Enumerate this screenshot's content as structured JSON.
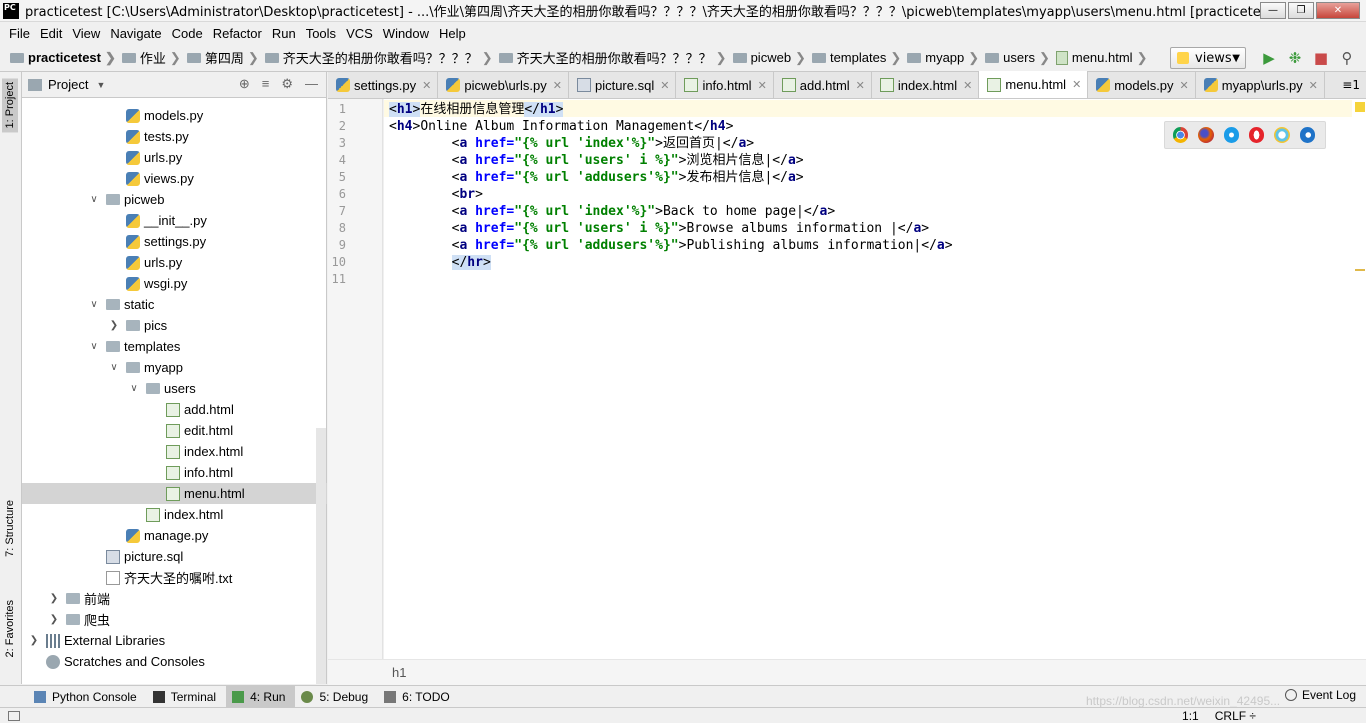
{
  "window": {
    "app_icon": "PC",
    "title": "practicetest [C:\\Users\\Administrator\\Desktop\\practicetest] - ...\\作业\\第四周\\齐天大圣的相册你敢看吗？？？？\\齐天大圣的相册你敢看吗？？？？\\picweb\\templates\\myapp\\users\\menu.html [practicetest] - PyCharm (Ad..."
  },
  "menu": [
    "File",
    "Edit",
    "View",
    "Navigate",
    "Code",
    "Refactor",
    "Run",
    "Tools",
    "VCS",
    "Window",
    "Help"
  ],
  "breadcrumbs": [
    "practicetest",
    "作业",
    "第四周",
    "齐天大圣的相册你敢看吗？？？？",
    "齐天大圣的相册你敢看吗？？？？",
    "picweb",
    "templates",
    "myapp",
    "users",
    "menu.html"
  ],
  "run_config": "views",
  "left_strip": {
    "project": "1: Project",
    "structure": "7: Structure",
    "favorites": "2: Favorites"
  },
  "project_panel": {
    "title": "Project",
    "tree": [
      {
        "label": "models.py",
        "type": "py",
        "depth": 4
      },
      {
        "label": "tests.py",
        "type": "py",
        "depth": 4
      },
      {
        "label": "urls.py",
        "type": "py",
        "depth": 4
      },
      {
        "label": "views.py",
        "type": "py",
        "depth": 4
      },
      {
        "label": "picweb",
        "type": "folder",
        "depth": 3,
        "arrow": "open"
      },
      {
        "label": "__init__.py",
        "type": "py",
        "depth": 4
      },
      {
        "label": "settings.py",
        "type": "py",
        "depth": 4
      },
      {
        "label": "urls.py",
        "type": "py",
        "depth": 4
      },
      {
        "label": "wsgi.py",
        "type": "py",
        "depth": 4
      },
      {
        "label": "static",
        "type": "folder",
        "depth": 3,
        "arrow": "open"
      },
      {
        "label": "pics",
        "type": "folder",
        "depth": 4,
        "arrow": "closed"
      },
      {
        "label": "templates",
        "type": "folder",
        "depth": 3,
        "arrow": "open"
      },
      {
        "label": "myapp",
        "type": "folder",
        "depth": 4,
        "arrow": "open"
      },
      {
        "label": "users",
        "type": "folder",
        "depth": 5,
        "arrow": "open"
      },
      {
        "label": "add.html",
        "type": "html",
        "depth": 6
      },
      {
        "label": "edit.html",
        "type": "html",
        "depth": 6
      },
      {
        "label": "index.html",
        "type": "html",
        "depth": 6
      },
      {
        "label": "info.html",
        "type": "html",
        "depth": 6
      },
      {
        "label": "menu.html",
        "type": "html",
        "depth": 6,
        "selected": true
      },
      {
        "label": "index.html",
        "type": "html",
        "depth": 5
      },
      {
        "label": "manage.py",
        "type": "py",
        "depth": 4
      },
      {
        "label": "picture.sql",
        "type": "sql",
        "depth": 3
      },
      {
        "label": "齐天大圣的嘱咐.txt",
        "type": "txt",
        "depth": 3
      },
      {
        "label": "前端",
        "type": "folder",
        "depth": 1,
        "arrow": "closed"
      },
      {
        "label": "爬虫",
        "type": "folder",
        "depth": 1,
        "arrow": "closed"
      },
      {
        "label": "External Libraries",
        "type": "lib",
        "depth": 0,
        "arrow": "closed"
      },
      {
        "label": "Scratches and Consoles",
        "type": "scratch",
        "depth": 0
      }
    ]
  },
  "tabs": [
    {
      "label": "settings.py",
      "type": "py"
    },
    {
      "label": "picweb\\urls.py",
      "type": "py"
    },
    {
      "label": "picture.sql",
      "type": "sql"
    },
    {
      "label": "info.html",
      "type": "html"
    },
    {
      "label": "add.html",
      "type": "html"
    },
    {
      "label": "index.html",
      "type": "html"
    },
    {
      "label": "menu.html",
      "type": "html",
      "active": true
    },
    {
      "label": "models.py",
      "type": "py"
    },
    {
      "label": "myapp\\urls.py",
      "type": "py"
    }
  ],
  "tab_overflow": "≡1",
  "code_lines": [
    "<h1>在线相册信息管理</h1>",
    "<h4>Online Album Information Management</h4>",
    "        <a href=\"{% url 'index'%}\">返回首页|</a>",
    "        <a href=\"{% url 'users' i %}\">浏览相片信息|</a>",
    "        <a href=\"{% url 'addusers'%}\">发布相片信息|</a>",
    "        <br>",
    "        <a href=\"{% url 'index'%}\">Back to home page|</a>",
    "        <a href=\"{% url 'users' i %}\">Browse albums information |</a>",
    "        <a href=\"{% url 'addusers'%}\">Publishing albums information|</a>",
    "        </hr>",
    ""
  ],
  "editor_breadcrumb": "h1",
  "browsers": [
    "chrome-icon",
    "firefox-icon",
    "safari-icon",
    "opera-icon",
    "ie-icon",
    "edge-icon"
  ],
  "bottom_tabs": [
    {
      "label": "Python Console"
    },
    {
      "label": "Terminal"
    },
    {
      "label": "4: Run",
      "active": true
    },
    {
      "label": "5: Debug"
    },
    {
      "label": "6: TODO"
    }
  ],
  "event_log": "Event Log",
  "watermark": "https://blog.csdn.net/weixin_42495...",
  "status": {
    "position": "1:1",
    "line_sep": "CRLF ÷"
  }
}
